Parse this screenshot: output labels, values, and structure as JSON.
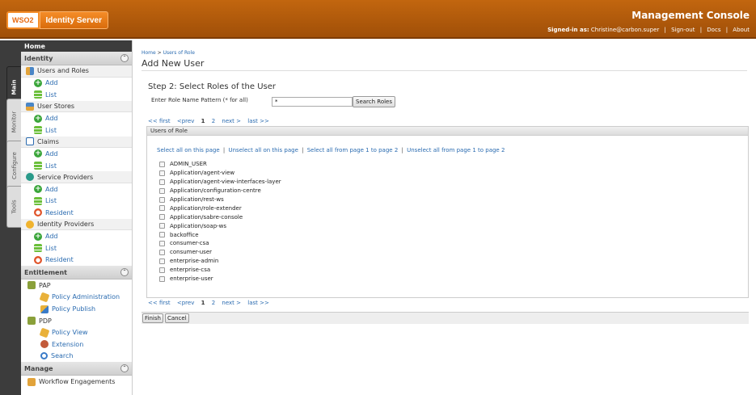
{
  "header": {
    "logo_brand": "WSO2",
    "logo_product": "Identity Server",
    "console_title": "Management Console",
    "signed_in_label": "Signed-in as:",
    "signed_in_user": "Christine@carbon.super",
    "sign_out": "Sign-out",
    "docs": "Docs",
    "about": "About",
    "link_separator": "|"
  },
  "tabs": {
    "main": "Main",
    "monitor": "Monitor",
    "configure": "Configure",
    "tools": "Tools"
  },
  "sidebar": {
    "home": "Home",
    "identity": {
      "title": "Identity",
      "users_and_roles": "Users and Roles",
      "ur_add": "Add",
      "ur_list": "List",
      "user_stores": "User Stores",
      "us_add": "Add",
      "us_list": "List",
      "claims": "Claims",
      "cl_add": "Add",
      "cl_list": "List",
      "service_providers": "Service Providers",
      "sp_add": "Add",
      "sp_list": "List",
      "sp_resident": "Resident",
      "identity_providers": "Identity Providers",
      "idp_add": "Add",
      "idp_list": "List",
      "idp_resident": "Resident"
    },
    "entitlement": {
      "title": "Entitlement",
      "pap": "PAP",
      "policy_administration": "Policy Administration",
      "policy_publish": "Policy Publish",
      "pdp": "PDP",
      "policy_view": "Policy View",
      "extension": "Extension",
      "search": "Search"
    },
    "manage": {
      "title": "Manage",
      "workflow_engagements": "Workflow Engagements"
    }
  },
  "main": {
    "breadcrumb_home": "Home",
    "breadcrumb_sep": " > ",
    "breadcrumb_current": "Users of Role",
    "page_title": "Add New User",
    "step_title": "Step 2: Select Roles of the User",
    "pattern_label": "Enter Role Name Pattern (* for all)",
    "pattern_value": "*",
    "search_button": "Search Roles",
    "pager": {
      "first": "<< first",
      "prev": "<prev",
      "page1": "1",
      "page2": "2",
      "next": "next >",
      "last": "last >>"
    },
    "panel_title": "Users of Role",
    "select_links": {
      "select_page": "Select all on this page",
      "unselect_page": "Unselect all on this page",
      "select_range": "Select all from page 1 to page 2",
      "unselect_range": "Unselect all from page 1 to page 2",
      "separator": "|"
    },
    "roles": [
      "ADMIN_USER",
      "Application/agent-view",
      "Application/agent-view-interfaces-layer",
      "Application/configuration-centre",
      "Application/rest-ws",
      "Application/role-extender",
      "Application/sabre-console",
      "Application/soap-ws",
      "backoffice",
      "consumer-csa",
      "consumer-user",
      "enterprise-admin",
      "enterprise-csa",
      "enterprise-user"
    ],
    "finish_button": "Finish",
    "cancel_button": "Cancel"
  }
}
